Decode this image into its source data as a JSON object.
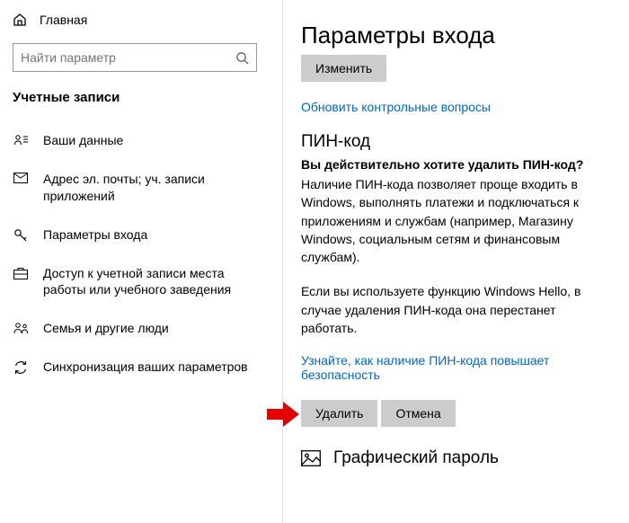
{
  "sidebar": {
    "home": "Главная",
    "search_placeholder": "Найти параметр",
    "section_title": "Учетные записи",
    "items": [
      {
        "label": "Ваши данные"
      },
      {
        "label": "Адрес эл. почты; уч. записи приложений"
      },
      {
        "label": "Параметры входа"
      },
      {
        "label": "Доступ к учетной записи места работы или учебного заведения"
      },
      {
        "label": "Семья и другие люди"
      },
      {
        "label": "Синхронизация ваших параметров"
      }
    ]
  },
  "main": {
    "title": "Параметры входа",
    "change_btn": "Изменить",
    "update_questions_link": "Обновить контрольные вопросы",
    "pin_heading": "ПИН-код",
    "confirm_question": "Вы действительно хотите удалить ПИН-код?",
    "pin_desc": "Наличие ПИН-кода позволяет проще входить в Windows, выполнять платежи и подключаться к приложениям и службам (например, Магазину Windows, социальным сетям и финансовым службам).",
    "hello_warning": "Если вы используете функцию Windows Hello, в случае удаления ПИН-кода она перестанет работать.",
    "learn_link": "Узнайте, как наличие ПИН-кода повышает безопасность",
    "delete_btn": "Удалить",
    "cancel_btn": "Отмена",
    "picpass_heading": "Графический пароль"
  }
}
